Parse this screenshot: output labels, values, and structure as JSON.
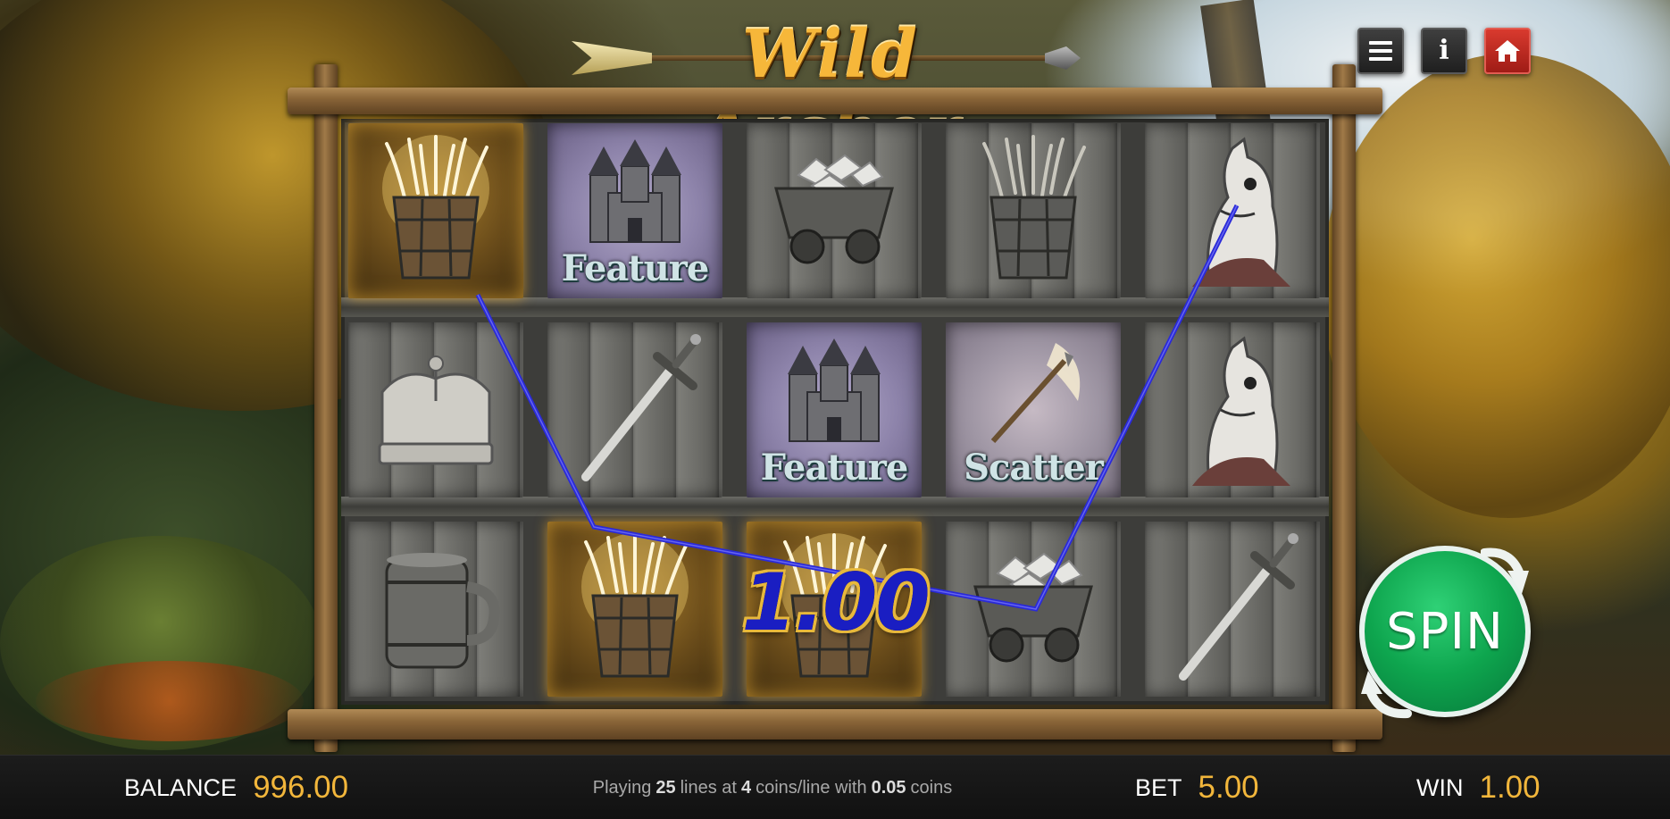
{
  "game": {
    "title": "Wild Archer"
  },
  "top_buttons": {
    "menu": "menu-icon",
    "info": "info-icon",
    "home": "home-icon"
  },
  "reels": {
    "rows": [
      [
        {
          "symbol": "wheat-basket",
          "label": "",
          "highlight": true
        },
        {
          "symbol": "castle",
          "label": "Feature",
          "highlight": false
        },
        {
          "symbol": "ore-cart",
          "label": "",
          "highlight": false
        },
        {
          "symbol": "wheat-basket",
          "label": "",
          "highlight": false
        },
        {
          "symbol": "horse",
          "label": "",
          "highlight": false
        }
      ],
      [
        {
          "symbol": "crown",
          "label": "",
          "highlight": false
        },
        {
          "symbol": "sword",
          "label": "",
          "highlight": false
        },
        {
          "symbol": "castle",
          "label": "Feature",
          "highlight": false
        },
        {
          "symbol": "arrow",
          "label": "Scatter",
          "highlight": false
        },
        {
          "symbol": "horse",
          "label": "",
          "highlight": false
        }
      ],
      [
        {
          "symbol": "barrel-mug",
          "label": "",
          "highlight": false
        },
        {
          "symbol": "wheat-basket",
          "label": "",
          "highlight": true
        },
        {
          "symbol": "wheat-basket",
          "label": "",
          "highlight": true
        },
        {
          "symbol": "ore-cart",
          "label": "",
          "highlight": false
        },
        {
          "symbol": "sword",
          "label": "",
          "highlight": false
        }
      ]
    ]
  },
  "win_display": {
    "amount": "1.00",
    "payline_color": "#2a2ad8"
  },
  "spin_button": {
    "label": "SPIN"
  },
  "bottom_bar": {
    "balance_label": "BALANCE",
    "balance_value": "996.00",
    "playing_prefix": "Playing",
    "lines": "25",
    "lines_text": "lines at",
    "coins_per_line": "4",
    "coins_per_line_text": "coins/line with",
    "coin_value": "0.05",
    "coin_text": "coins",
    "bet_label": "BET",
    "bet_value": "5.00",
    "win_label": "WIN",
    "win_value": "1.00"
  },
  "colors": {
    "accent_gold": "#f2b63b",
    "spin_green": "#0ea54e",
    "home_red": "#c42a22",
    "payline_blue": "#2a2ad8"
  }
}
